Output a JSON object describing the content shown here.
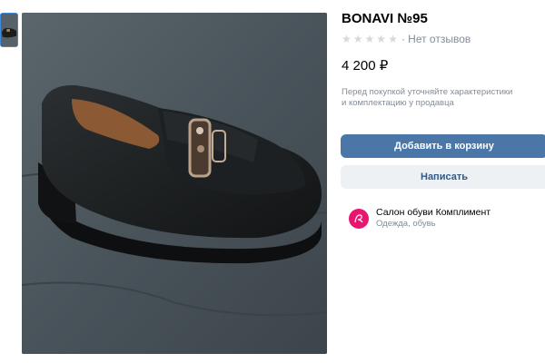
{
  "product": {
    "title": "BONAVI №95",
    "reviews_text": "· Нет отзывов",
    "rating_stars": 0,
    "price": "4 200 ₽",
    "hint_line1": "Перед покупкой уточняйте характеристики",
    "hint_line2": "и комплектацию у продавца"
  },
  "actions": {
    "add_to_cart": "Добавить в корзину",
    "message": "Написать"
  },
  "seller": {
    "name": "Салон обуви Комплимент",
    "category": "Одежда, обувь"
  },
  "colors": {
    "primary_button": "#4a76a8",
    "secondary_button": "#eef1f4",
    "muted_text": "#818c99",
    "accent": "#3f8ae0",
    "avatar": "#e8166f"
  }
}
